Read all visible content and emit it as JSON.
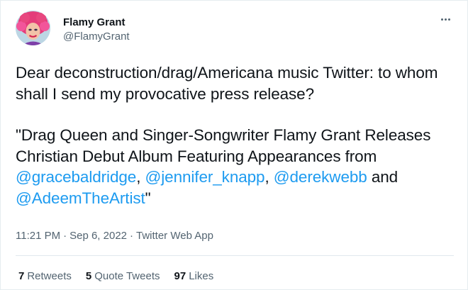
{
  "author": {
    "display_name": "Flamy Grant",
    "handle": "@FlamyGrant",
    "avatar_icon": "drag-queen-avatar"
  },
  "more_icon": "more-horizontal-icon",
  "tweet": {
    "paragraph1": "Dear deconstruction/drag/Americana music Twitter: to whom shall I send my provocative press release?",
    "quote_open": "\"Drag Queen and Singer-Songwriter Flamy Grant Releases Christian Debut Album Featuring Appearances from ",
    "mention1": "@gracebaldridge",
    "sep1": ", ",
    "mention2": "@jennifer_knapp",
    "sep2": ", ",
    "mention3": "@derekwebb",
    "and_text": " and ",
    "mention4": "@AdeemTheArtist",
    "quote_close": "\""
  },
  "meta": {
    "time": "11:21 PM",
    "date": "Sep 6, 2022",
    "source": "Twitter Web App",
    "separator": "·"
  },
  "stats": {
    "retweets_count": "7",
    "retweets_label": "Retweets",
    "quotes_count": "5",
    "quotes_label": "Quote Tweets",
    "likes_count": "97",
    "likes_label": "Likes"
  },
  "colors": {
    "link": "#1d9bf0",
    "text": "#0f1419",
    "secondary": "#536471"
  }
}
